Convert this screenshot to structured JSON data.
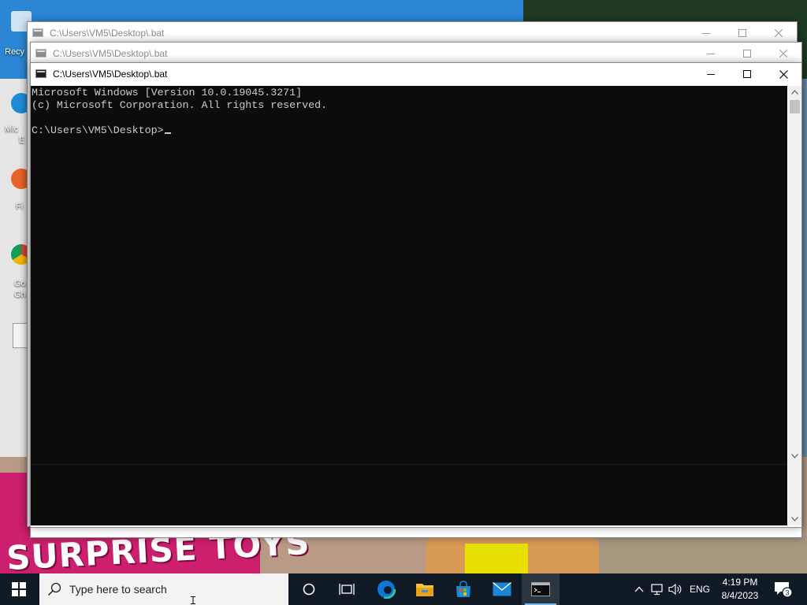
{
  "desktop": {
    "icons": [
      {
        "label": "Recy"
      },
      {
        "label": "Mic"
      },
      {
        "label": "E"
      },
      {
        "label": "Fi"
      },
      {
        "label": "Go"
      },
      {
        "label": "Gh"
      }
    ],
    "wallpaper_text": "SURPRISE TOYS"
  },
  "windows": {
    "back": {
      "title": "C:\\Users\\VM5\\Desktop\\.bat"
    },
    "middle": {
      "title": "C:\\Users\\VM5\\Desktop\\.bat"
    },
    "front": {
      "title": "C:\\Users\\VM5\\Desktop\\.bat",
      "console_lines": [
        "Microsoft Windows [Version 10.0.19045.3271]",
        "(c) Microsoft Corporation. All rights reserved.",
        "",
        "C:\\Users\\VM5\\Desktop>"
      ]
    }
  },
  "taskbar": {
    "search_placeholder": "Type here to search",
    "pinned": [
      "start-icon",
      "cortana-icon",
      "task-view-icon",
      "edge-icon",
      "file-explorer-icon",
      "store-icon",
      "mail-icon",
      "cmd-icon"
    ],
    "tray": {
      "language": "ENG",
      "time": "4:19 PM",
      "date": "8/4/2023",
      "notification_count": "3"
    }
  },
  "colors": {
    "console_bg": "#0c0c0c",
    "console_fg": "#cccccc",
    "taskbar_bg": "#101a24",
    "accent": "#76b9ed"
  }
}
